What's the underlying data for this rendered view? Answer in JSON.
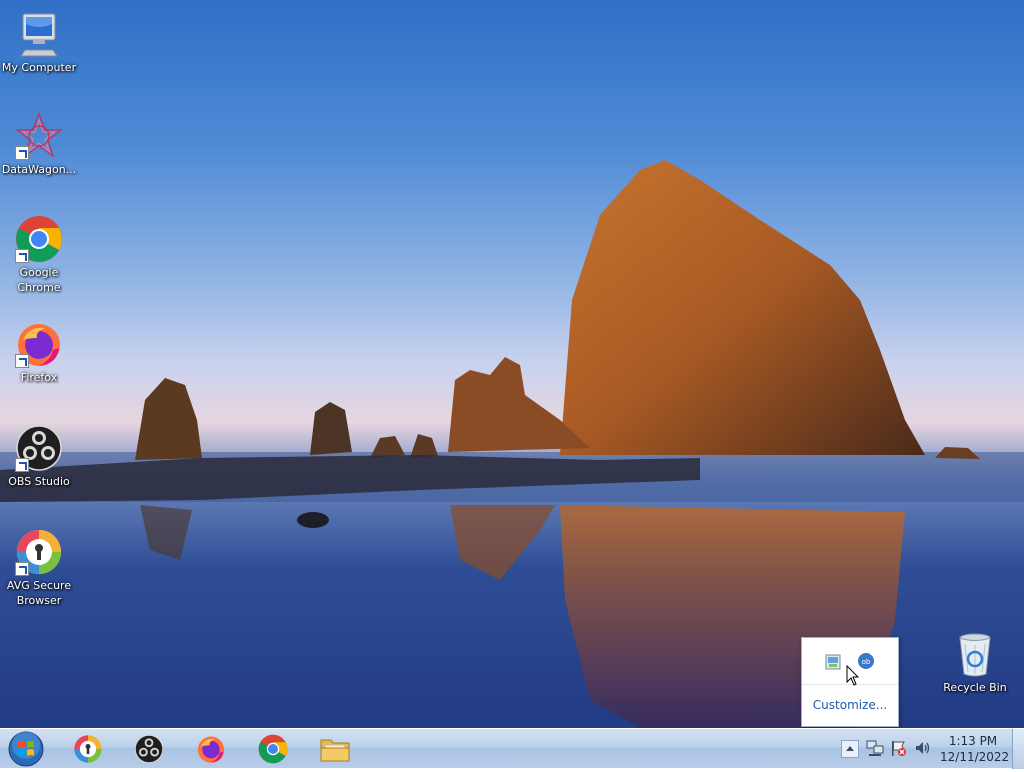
{
  "desktop": {
    "icons": [
      {
        "label": "My Computer",
        "icon": "computer-icon"
      },
      {
        "label": "DataWagon...",
        "icon": "datawagon-icon"
      },
      {
        "label": "Google Chrome",
        "icon": "chrome-icon"
      },
      {
        "label": "Firefox",
        "icon": "firefox-icon"
      },
      {
        "label": "OBS Studio",
        "icon": "obs-icon"
      },
      {
        "label": "AVG Secure Browser",
        "icon": "avg-browser-icon"
      },
      {
        "label": "Recycle Bin",
        "icon": "recycle-bin-icon"
      }
    ]
  },
  "taskbar": {
    "pinned": [
      "avg-browser-icon",
      "obs-icon",
      "firefox-icon",
      "chrome-icon",
      "folder-icon"
    ],
    "tray": [
      "show-hidden-icons-icon",
      "network-icon",
      "action-center-flag-icon",
      "volume-icon"
    ],
    "clock": {
      "time": "1:13 PM",
      "date": "12/11/2022"
    }
  },
  "overflow_popup": {
    "icons": [
      "printer-tray-icon",
      "obs-tray-icon"
    ],
    "customize_label": "Customize..."
  },
  "colors": {
    "taskbar_top": "#d4e2f2",
    "taskbar_bottom": "#a9c3e3",
    "link": "#1e5aa8"
  }
}
